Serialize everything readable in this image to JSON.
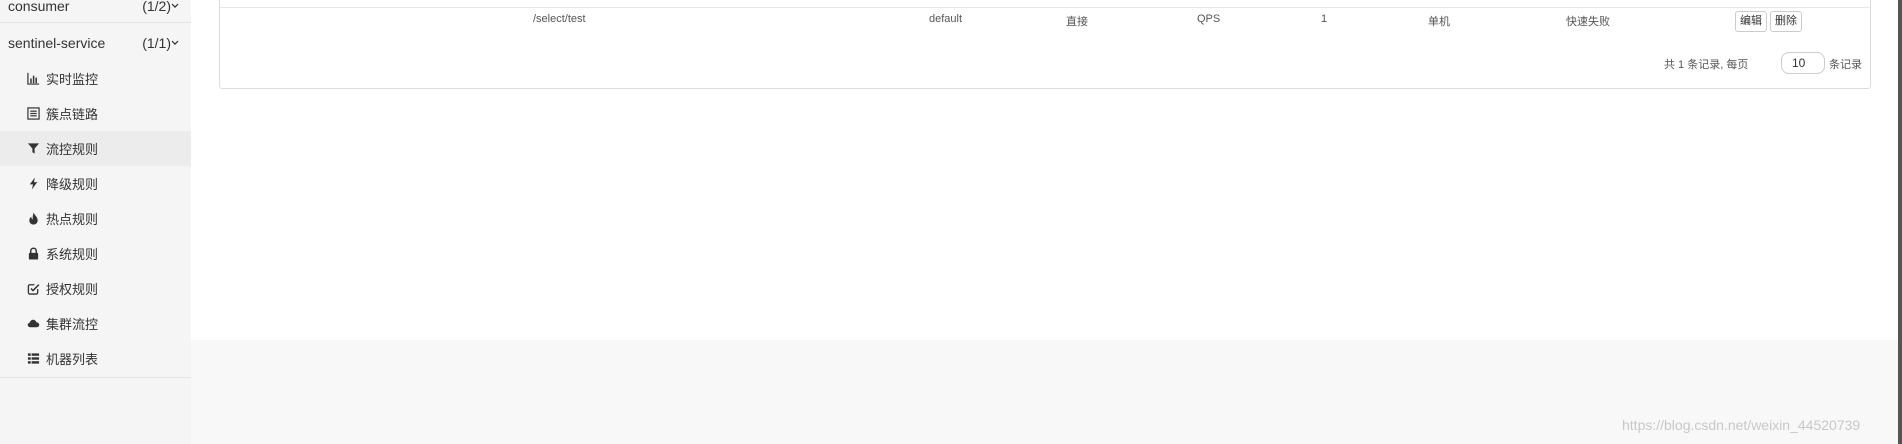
{
  "sidebar": {
    "apps": [
      {
        "name": "consumer",
        "count": "(1/2)"
      },
      {
        "name": "sentinel-service",
        "count": "(1/1)"
      }
    ],
    "menu": [
      {
        "label": "实时监控",
        "icon": "bar-chart-icon",
        "active": false
      },
      {
        "label": "簇点链路",
        "icon": "list-alt-icon",
        "active": false
      },
      {
        "label": "流控规则",
        "icon": "filter-icon",
        "active": true
      },
      {
        "label": "降级规则",
        "icon": "flash-icon",
        "active": false
      },
      {
        "label": "热点规则",
        "icon": "fire-icon",
        "active": false
      },
      {
        "label": "系统规则",
        "icon": "lock-icon",
        "active": false
      },
      {
        "label": "授权规则",
        "icon": "check-icon",
        "active": false
      },
      {
        "label": "集群流控",
        "icon": "cloud-icon",
        "active": false
      },
      {
        "label": "机器列表",
        "icon": "th-list-icon",
        "active": false
      }
    ]
  },
  "table": {
    "row": {
      "resource": "/select/test",
      "limit_app": "default",
      "strategy": "直接",
      "grade": "QPS",
      "threshold": "1",
      "mode": "单机",
      "control": "快速失败"
    },
    "actions": {
      "edit": "编辑",
      "delete": "删除"
    }
  },
  "pagination": {
    "summary": "共 1 条记录, 每页",
    "page_size": "10",
    "suffix": "条记录"
  },
  "watermark": "https://blog.csdn.net/weixin_44520739",
  "colors": {
    "active_bg": "#ececec",
    "sidebar_bg": "#f5f5f5",
    "main_bg": "#ffffff"
  }
}
